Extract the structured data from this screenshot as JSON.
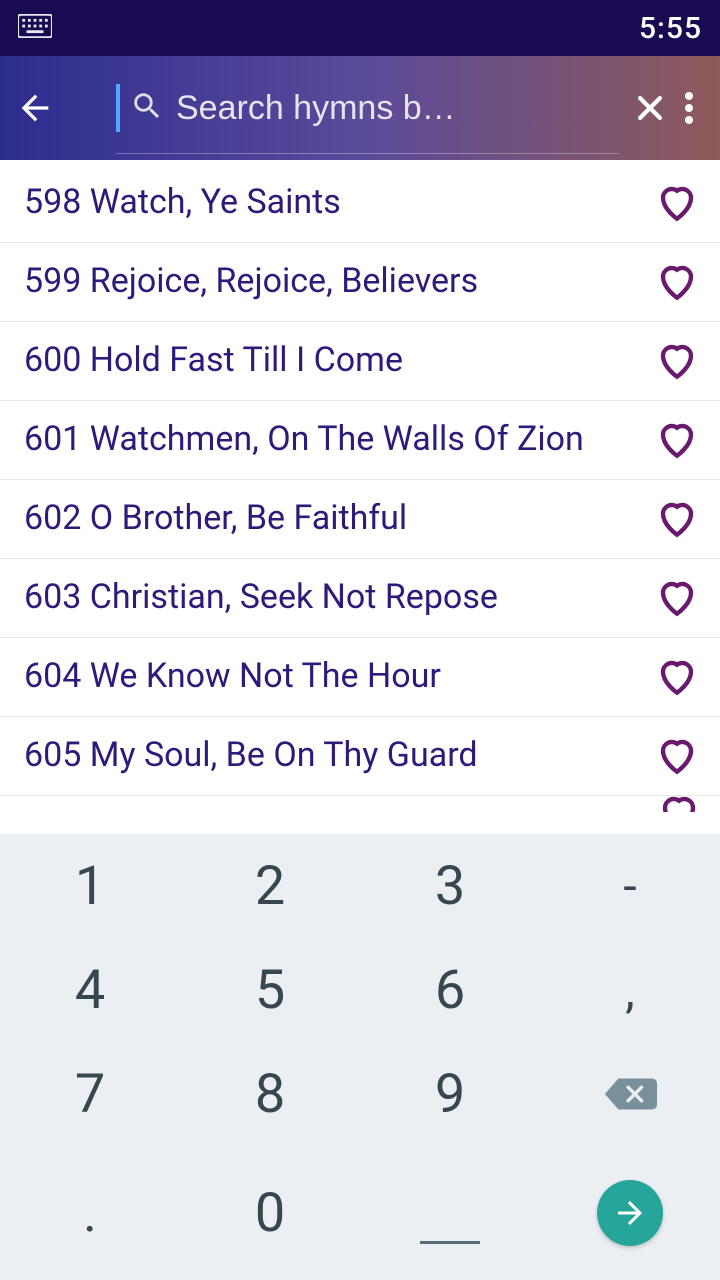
{
  "status": {
    "time": "5:55"
  },
  "search": {
    "placeholder": "Search hymns b…"
  },
  "hymns": [
    {
      "label": "598 Watch, Ye Saints"
    },
    {
      "label": "599 Rejoice, Rejoice, Believers"
    },
    {
      "label": "600 Hold Fast Till I Come"
    },
    {
      "label": "601 Watchmen, On The Walls Of Zion"
    },
    {
      "label": "602 O Brother, Be Faithful"
    },
    {
      "label": "603 Christian, Seek Not Repose"
    },
    {
      "label": "604 We Know Not The Hour"
    },
    {
      "label": "605 My Soul, Be On Thy Guard"
    }
  ],
  "keypad": {
    "r1": [
      "1",
      "2",
      "3",
      "-"
    ],
    "r2": [
      "4",
      "5",
      "6",
      ","
    ],
    "r3": [
      "7",
      "8",
      "9"
    ],
    "r4": [
      ".",
      "0"
    ]
  }
}
